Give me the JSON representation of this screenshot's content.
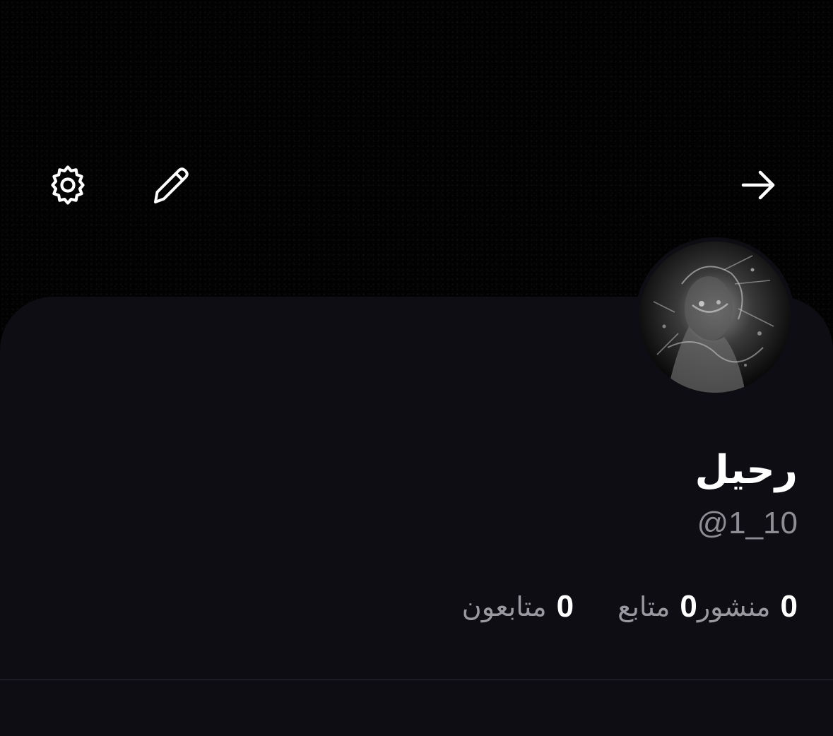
{
  "header": {
    "settings_icon": "gear-icon",
    "edit_icon": "pencil-icon",
    "back_icon": "arrow-right-icon"
  },
  "profile": {
    "display_name": "رحيل",
    "handle": "@1_10",
    "avatar": "profile-photo"
  },
  "stats": [
    {
      "count": "0",
      "label": "متابعون"
    },
    {
      "count": "0",
      "label": "متابع"
    },
    {
      "count": "0",
      "label": "منشور"
    }
  ],
  "colors": {
    "background": "#000000",
    "panel": "#0e0d14",
    "primary_text": "#ffffff",
    "secondary_text": "#8e8d94",
    "divider": "#2c2b33"
  }
}
